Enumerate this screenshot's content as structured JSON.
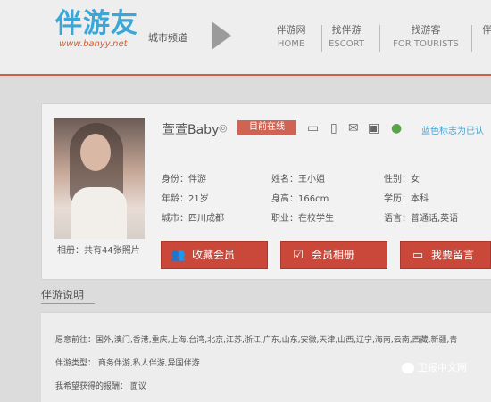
{
  "header": {
    "logo_text": "伴游友",
    "logo_url": "www.banyy.net",
    "city_channel": "城市频道",
    "nav": [
      {
        "label": "伴游网",
        "sub": "HOME"
      },
      {
        "label": "找伴游",
        "sub": "ESCORT"
      },
      {
        "label": "找游客",
        "sub": "FOR TOURISTS"
      },
      {
        "label": "伴"
      }
    ]
  },
  "profile": {
    "name": "萱萱Baby",
    "name_mark": "◎",
    "online_badge": "目前在线",
    "legend": "蓝色标志为已认",
    "album_count": "相册：共有44张照片",
    "info": {
      "identity": "身份：伴游",
      "age": "年龄：21岁",
      "city": "城市：四川成都",
      "real_name": "姓名：王小姐",
      "height": "身高：166cm",
      "occupation": "职业：在校学生",
      "gender": "性别：女",
      "education": "学历：本科",
      "language": "语言：普通话,英语"
    },
    "buttons": {
      "favorite": "收藏会员",
      "album": "会员相册",
      "message": "我要留言"
    }
  },
  "section": {
    "title": "伴游说明",
    "wish_places": "愿意前往：国外,澳门,香港,重庆,上海,台湾,北京,江苏,浙江,广东,山东,安徽,天津,山西,辽宁,海南,云南,西藏,新疆,青",
    "type": "伴游类型：  商务伴游,私人伴游,异国伴游",
    "reward": "我希望获得的报酬：  面议"
  },
  "watermark": "卫报中文网"
}
